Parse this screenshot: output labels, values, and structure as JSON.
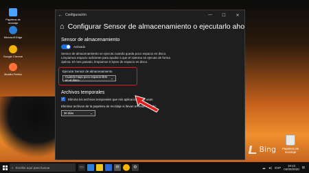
{
  "desktop": {
    "icons": [
      {
        "label": "Papelera de reciclaje",
        "color": "#4aa3ff"
      },
      {
        "label": "Microsoft Edge",
        "color": "#2e7fd8"
      },
      {
        "label": "Google Chrome",
        "color": "#f4b400"
      },
      {
        "label": "Mozilla Firefox",
        "color": "#ff7139"
      }
    ],
    "watermark": "Bing",
    "recycle_bin": "Papelera de reciclaje"
  },
  "window": {
    "titlebar": "Configuración",
    "page_title": "Configurar Sensor de almacenamiento o ejecutarlo ahora",
    "section_storage_sense": "Sensor de almacenamiento",
    "toggle_state": "Activado",
    "description": "Sensor de almacenamiento se ejecuta cuando queda poco espacio en disco. Limpiamos espacio suficiente para ayudar a que el sistema se ejecute de forma óptima. El mes pasado, limpiamos 0 bytes de espacio en disco.",
    "run_label": "Ejecutar Sensor de almacenamiento",
    "run_value": "Cuando haya poco espacio libre en el disco",
    "section_temp": "Archivos temporales",
    "temp_checkbox_label": "Elimina los archivos temporales que mis aplicaciones no usan",
    "recycle_label": "Eliminar archivos de la papelera de reciclaje si llevan en esta más de:",
    "recycle_value": "30 días"
  },
  "taskbar": {
    "search_placeholder": "Escribe aquí para buscar",
    "time": "18:42",
    "date": "04/05/2020",
    "lang": "ESP"
  },
  "colors": {
    "accent": "#1f6fd8",
    "highlight_red": "#e21b1b"
  }
}
